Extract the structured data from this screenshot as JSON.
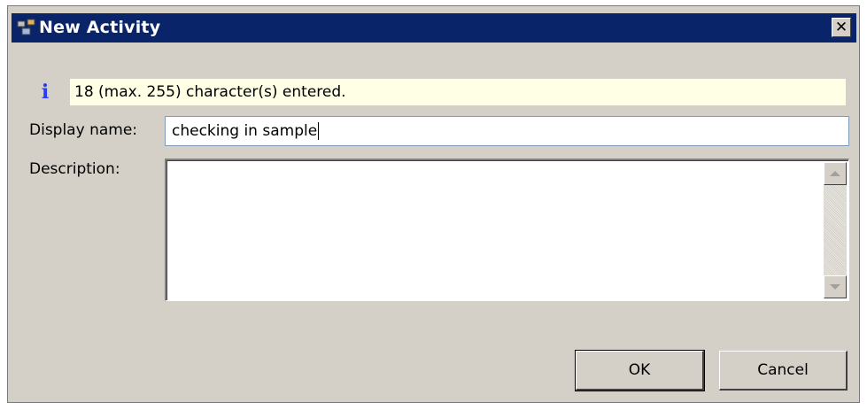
{
  "window": {
    "title": "New Activity",
    "icon": "activity-app-icon",
    "close_symbol": "✕"
  },
  "info": {
    "icon": "i",
    "message": "18 (max. 255) character(s) entered."
  },
  "form": {
    "display_name_label": "Display name:",
    "display_name_value": "checking in sample",
    "description_label": "Description:",
    "description_value": ""
  },
  "buttons": {
    "ok_label": "OK",
    "cancel_label": "Cancel"
  },
  "colors": {
    "titlebar": "#0a246a",
    "dialog_bg": "#d4d0c8",
    "info_bg": "#ffffe6",
    "info_icon": "#2a3cf0"
  }
}
